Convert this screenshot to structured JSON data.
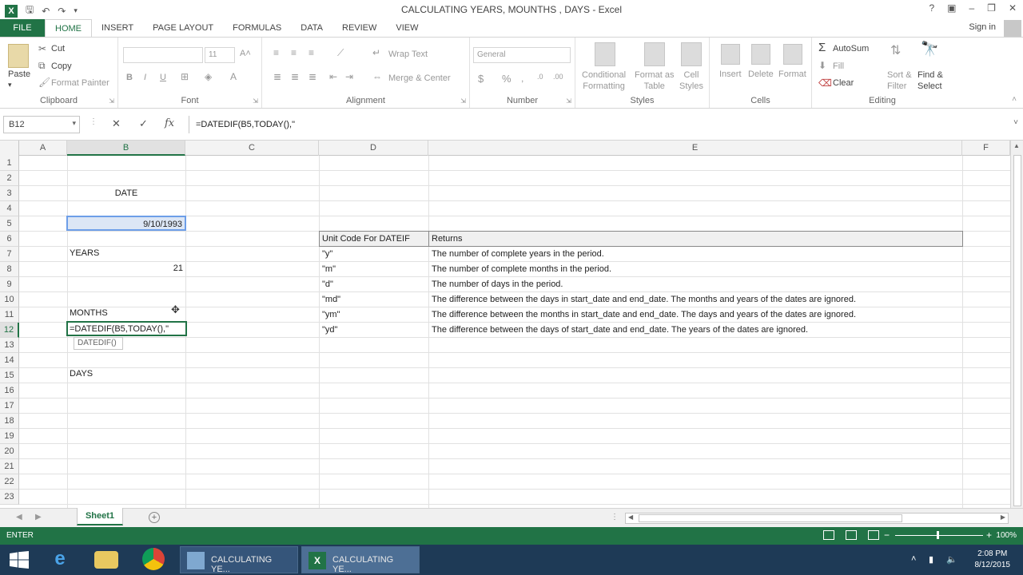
{
  "window": {
    "title": "CALCULATING YEARS, MOUNTHS , DAYS - Excel",
    "help": "?",
    "min": "–",
    "restore": "❐",
    "close": "✕"
  },
  "tabs": [
    "FILE",
    "HOME",
    "INSERT",
    "PAGE LAYOUT",
    "FORMULAS",
    "DATA",
    "REVIEW",
    "VIEW"
  ],
  "signin": "Sign in",
  "ribbon": {
    "clipboard": {
      "label": "Clipboard",
      "paste": "Paste",
      "cut": "Cut",
      "copy": "Copy",
      "format_painter": "Format Painter"
    },
    "font": {
      "label": "Font",
      "size": "11",
      "bold": "B",
      "italic": "I",
      "underline": "U"
    },
    "alignment": {
      "label": "Alignment",
      "wrap": "Wrap Text",
      "merge": "Merge & Center"
    },
    "number": {
      "label": "Number",
      "format": "General",
      "currency": "$",
      "percent": "%"
    },
    "styles": {
      "label": "Styles",
      "conditional": "Conditional\nFormatting",
      "format_table": "Format as\nTable",
      "cell_styles": "Cell\nStyles"
    },
    "cells": {
      "label": "Cells",
      "insert": "Insert",
      "delete": "Delete",
      "format": "Format"
    },
    "editing": {
      "label": "Editing",
      "autosum": "AutoSum",
      "fill": "Fill",
      "clear": "Clear",
      "sort": "Sort &\nFilter",
      "find": "Find &\nSelect"
    }
  },
  "formula_bar": {
    "namebox": "B12",
    "cancel": "✕",
    "enter": "✓",
    "fx": "fx",
    "formula": "=DATEDIF(B5,TODAY(),\""
  },
  "columns": [
    "A",
    "B",
    "C",
    "D",
    "E",
    "F"
  ],
  "rows": [
    "1",
    "2",
    "3",
    "4",
    "5",
    "6",
    "7",
    "8",
    "9",
    "10",
    "11",
    "12",
    "13",
    "14",
    "15",
    "16",
    "17",
    "18",
    "19",
    "20",
    "21",
    "22",
    "23"
  ],
  "cells": {
    "b3": "DATE",
    "b5": "9/10/1993",
    "b7": "YEARS",
    "b8": "21",
    "b11": "MONTHS",
    "b12": "=DATEDIF(B5,TODAY(),\"",
    "tooltip": "DATEDIF()",
    "b15": "DAYS"
  },
  "table": {
    "headers": [
      "Unit Code For DATEIF",
      "Returns"
    ],
    "rows": [
      [
        "\"y\"",
        "The number of complete years in the period."
      ],
      [
        "\"m\"",
        "The number of complete months in the period."
      ],
      [
        "\"d\"",
        "The number of days in the period."
      ],
      [
        "\"md\"",
        "The difference between the days in start_date and end_date. The months and years of the dates are ignored."
      ],
      [
        "\"ym\"",
        "The difference between the months in start_date and end_date. The days and years of the dates are ignored."
      ],
      [
        "\"yd\"",
        "The difference between the days of start_date and end_date. The years of the dates are ignored."
      ]
    ]
  },
  "sheet": {
    "tab": "Sheet1",
    "add": "+"
  },
  "status": {
    "mode": "ENTER",
    "zoom": "100%"
  },
  "taskbar": {
    "windows": [
      "CALCULATING YE...",
      "CALCULATING YE..."
    ],
    "time": "2:08 PM",
    "date": "8/12/2015"
  },
  "colors": {
    "accent": "#217346",
    "taskbar": "#1e3a56"
  }
}
